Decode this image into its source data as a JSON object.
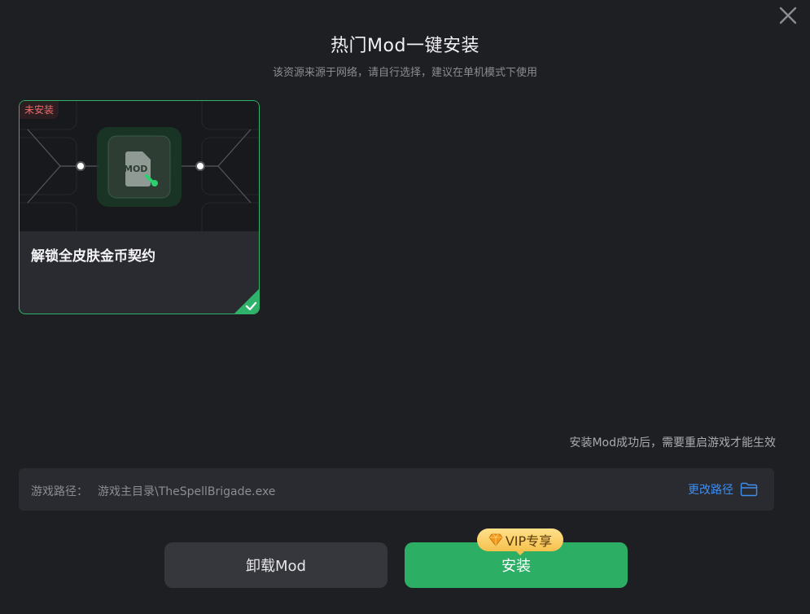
{
  "dialog": {
    "title": "热门Mod一键安装",
    "subtitle": "该资源来源于网络，请自行选择，建议在单机模式下使用",
    "close_icon": "close-icon"
  },
  "mods": [
    {
      "badge": "未安装",
      "icon_text": "MOD",
      "title": "解锁全皮肤金币契约",
      "selected": true
    }
  ],
  "notice": "安装Mod成功后，需要重启游戏才能生效",
  "path": {
    "label": "游戏路径：",
    "value": "游戏主目录\\TheSpellBrigade.exe",
    "change_label": "更改路径"
  },
  "buttons": {
    "uninstall": "卸载Mod",
    "install": "安装",
    "vip_label": "VIP专享"
  },
  "colors": {
    "background": "#1e1f23",
    "accent_green": "#2cae64",
    "link_blue": "#3e8ef0",
    "badge_red": "#f06b6b",
    "vip_gold": "#f6c14e"
  }
}
